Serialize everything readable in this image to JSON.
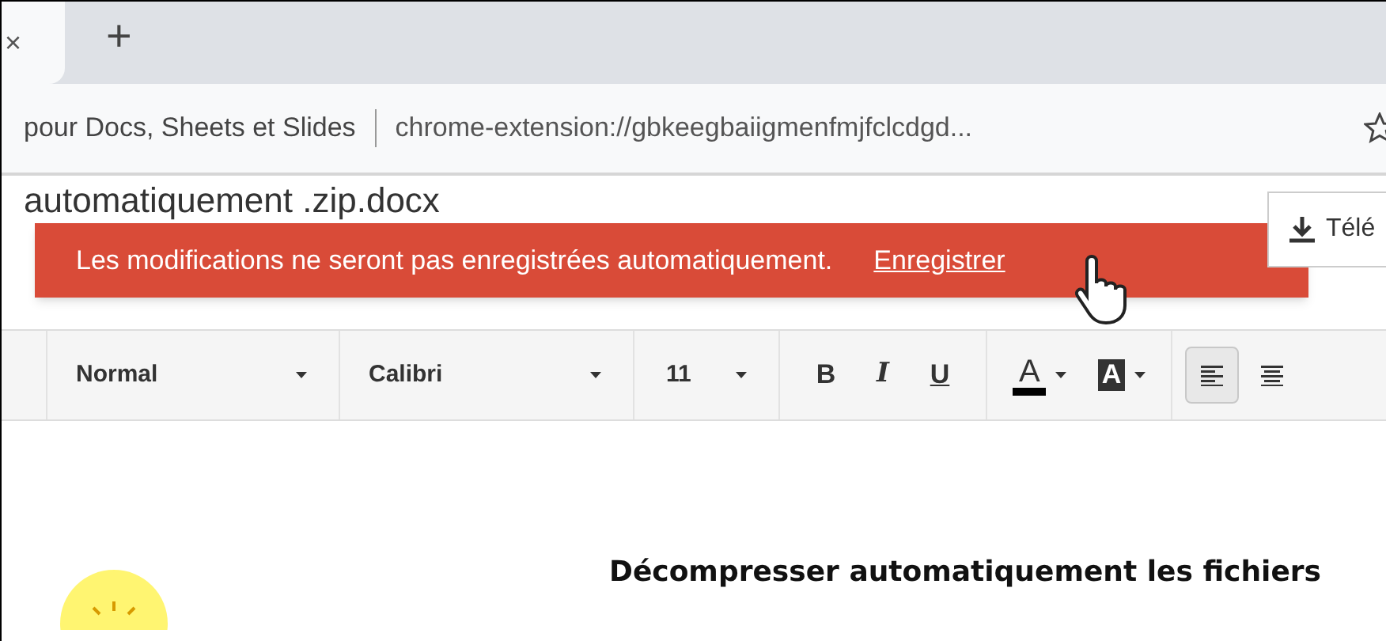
{
  "browser": {
    "tab_close": "×",
    "new_tab": "+",
    "page_title": "pour Docs, Sheets et Slides",
    "url": "chrome-extension://gbkeegbaiigmenfmjfclcdgd..."
  },
  "document": {
    "title": "automatiquement .zip.docx",
    "download_label": "Télé"
  },
  "banner": {
    "message": "Les modifications ne seront pas enregistrées automatiquement.",
    "action": "Enregistrer"
  },
  "toolbar": {
    "style": "Normal",
    "font": "Calibri",
    "size": "11",
    "format_buttons": [
      {
        "kind": "bold",
        "label": "B",
        "selected": false
      },
      {
        "kind": "italic",
        "label": "I",
        "selected": false
      },
      {
        "kind": "underline",
        "label": "U",
        "selected": false
      }
    ],
    "color_buttons": [
      {
        "kind": "text",
        "label": "A"
      },
      {
        "kind": "highlight",
        "label": "A"
      }
    ],
    "align_buttons": [
      {
        "kind": "left",
        "selected": true
      },
      {
        "kind": "center",
        "selected": false
      }
    ]
  },
  "body": {
    "heading": "Décompresser automatiquement les fichiers"
  }
}
